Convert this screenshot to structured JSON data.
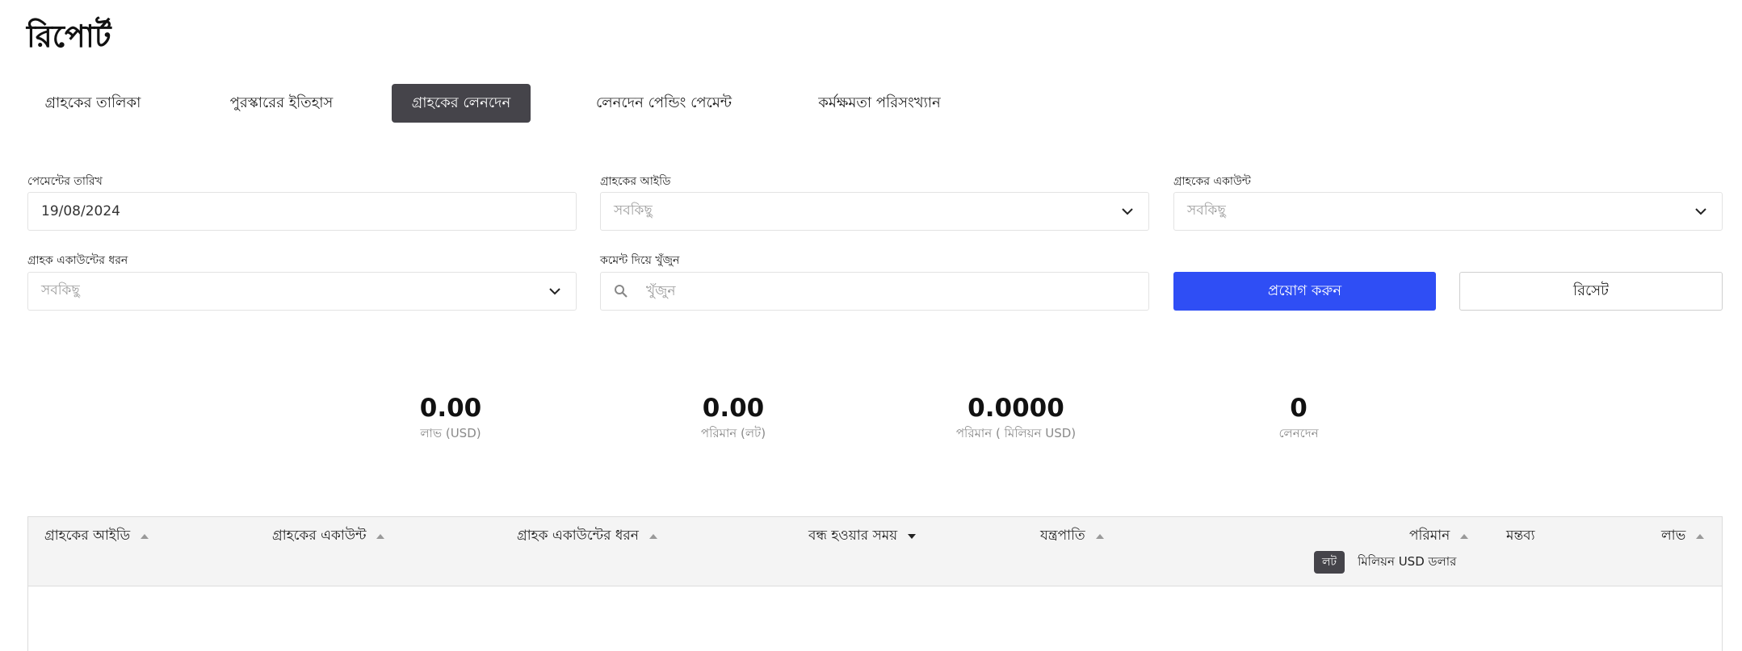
{
  "page": {
    "title": "রিপোর্ট"
  },
  "tabs": [
    {
      "label": "গ্রাহকের তালিকা",
      "active": false
    },
    {
      "label": "পুরস্কারের ইতিহাস",
      "active": false
    },
    {
      "label": "গ্রাহকের লেনদেন",
      "active": true
    },
    {
      "label": "লেনদেন পেন্ডিং পেমেন্ট",
      "active": false
    },
    {
      "label": "কর্মক্ষমতা পরিসংখ্যান",
      "active": false
    }
  ],
  "filters": {
    "payment_date": {
      "label": "পেমেন্টের তারিখ",
      "value": "19/08/2024"
    },
    "client_id": {
      "label": "গ্রাহকের আইডি",
      "placeholder": "সবকিছু"
    },
    "client_account": {
      "label": "গ্রাহকের একাউন্ট",
      "placeholder": "সবকিছু"
    },
    "account_type": {
      "label": "গ্রাহক একাউন্টের ধরন",
      "placeholder": "সবকিছু"
    },
    "comment_search": {
      "label": "কমেন্ট দিয়ে খুঁজুন",
      "placeholder": "খুঁজুন"
    },
    "apply_label": "প্রয়োগ করুন",
    "reset_label": "রিসেট"
  },
  "stats": [
    {
      "value": "0.00",
      "label": "লাভ (USD)"
    },
    {
      "value": "0.00",
      "label": "পরিমান (লট)"
    },
    {
      "value": "0.0000",
      "label": "পরিমান ( মিলিয়ন USD)"
    },
    {
      "value": "0",
      "label": "লেনদেন"
    }
  ],
  "table": {
    "columns": [
      {
        "label": "গ্রাহকের আইডি",
        "sort": "asc"
      },
      {
        "label": "গ্রাহকের একাউন্ট",
        "sort": "asc"
      },
      {
        "label": "গ্রাহক একাউন্টের ধরন",
        "sort": "asc"
      },
      {
        "label": "বন্ধ হওয়ার সময়",
        "sort": "desc"
      },
      {
        "label": "যন্ত্রপাতি",
        "sort": "asc"
      },
      {
        "label": "পরিমান",
        "sort": "asc"
      },
      {
        "label": "মন্তব্য",
        "sort": "none"
      },
      {
        "label": "লাভ",
        "sort": "asc"
      }
    ],
    "volume_units": {
      "lot": "লট",
      "million_usd": "মিলিয়ন USD ডলার"
    }
  },
  "icons": {
    "chevron": "chevron-down-icon",
    "search": "search-icon",
    "sort_up": "sort-asc-icon",
    "sort_down": "sort-desc-icon"
  },
  "colors": {
    "primary": "#2f4ef5",
    "active_tab": "#45444a"
  }
}
